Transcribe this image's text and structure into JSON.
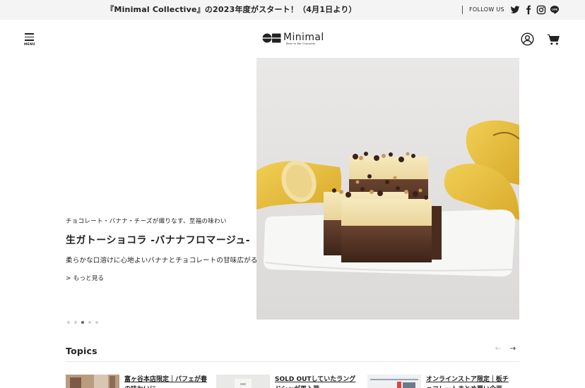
{
  "announcement": {
    "text": "『Minimal Collective』の2023年度がスタート！（4月1日より）",
    "follow_label": "FOLLOW US"
  },
  "social": [
    "twitter-icon",
    "facebook-icon",
    "instagram-icon",
    "line-icon"
  ],
  "header": {
    "menu_label": "MENU",
    "logo_text": "Minimal",
    "logo_subtext": "Bean to Bar Chocolate"
  },
  "hero": {
    "subtitle": "チョコレート・バナナ・チーズが織りなす、至福の味わい",
    "title": "生ガトーショコラ -バナナフロマージュ-",
    "description": "柔らかな口溶けに心地よいバナナとチョコレートの甘味広がるガトーショコラ。",
    "more_label": "もっと見る",
    "slide_count": 5,
    "active_slide": 3
  },
  "topics": {
    "heading": "Topics",
    "prev_label": "←",
    "next_label": "→",
    "items": [
      {
        "title": "富ヶ谷本店限定｜パフェが春の味わいに"
      },
      {
        "title": "SOLD OUTしていたラングドシャが再入荷"
      },
      {
        "title": "オンラインストア限定｜板チョコレートまとめ買い企画"
      }
    ]
  },
  "colors": {
    "announce_bg": "#f4f4f4",
    "text": "#222222",
    "dot_active": "#666666",
    "dot_inactive": "#d0d0d0"
  }
}
